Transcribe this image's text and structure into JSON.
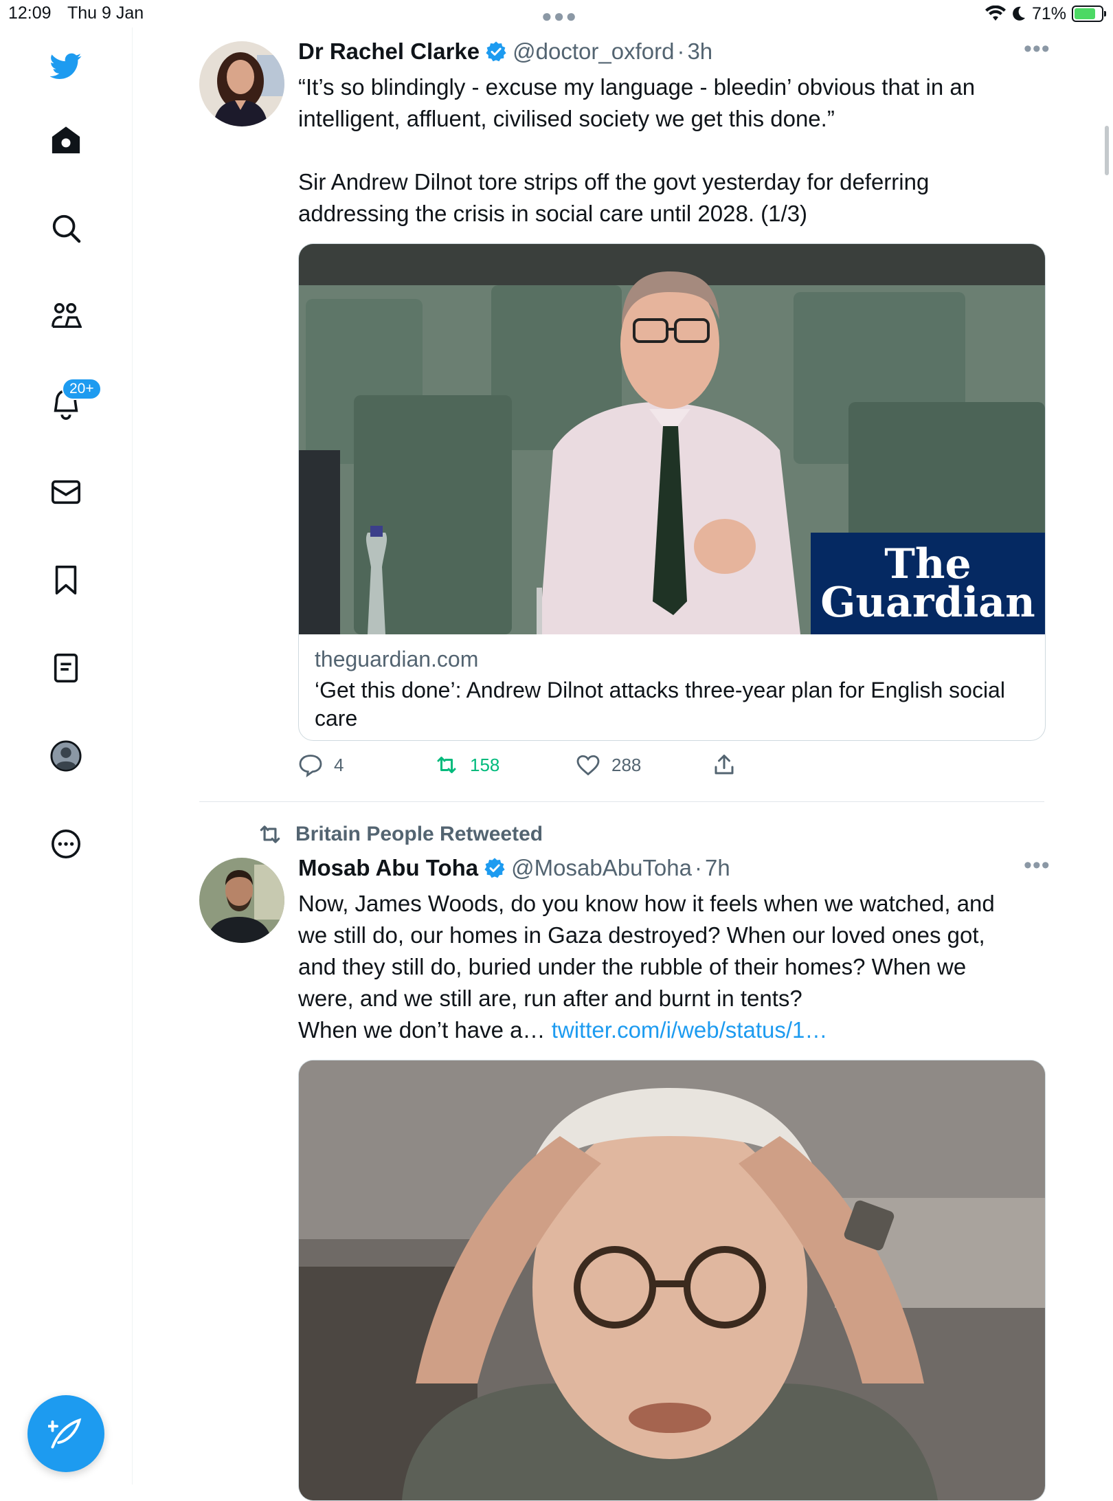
{
  "status_bar": {
    "time": "12:09",
    "date": "Thu 9 Jan",
    "battery": "71%",
    "battery_level": 0.71
  },
  "sidebar": {
    "items": [
      {
        "icon": "twitter-logo-icon"
      },
      {
        "icon": "home-icon"
      },
      {
        "icon": "search-icon"
      },
      {
        "icon": "communities-icon"
      },
      {
        "icon": "notifications-icon",
        "badge": "20+"
      },
      {
        "icon": "messages-icon"
      },
      {
        "icon": "bookmarks-icon"
      },
      {
        "icon": "lists-icon"
      },
      {
        "icon": "profile-icon"
      },
      {
        "icon": "more-icon"
      }
    ],
    "compose_icon": "compose-tweet-icon"
  },
  "tweets": [
    {
      "name": "Dr Rachel Clarke",
      "handle": "@doctor_oxford",
      "sep": "·",
      "time": "3h",
      "text": [
        "“It’s so blindingly - excuse my language - bleedin’ obvious that in an",
        "intelligent, affluent, civilised society we get this done.”",
        "",
        "Sir Andrew Dilnot tore strips off the govt yesterday for deferring",
        "addressing the crisis in social care until 2028. (1/3)"
      ],
      "card": {
        "logo_line1": "The",
        "logo_line2": "Guardian",
        "domain": "theguardian.com",
        "title": "‘Get this done’: Andrew Dilnot attacks three-year plan for English social care"
      },
      "actions": {
        "replies": "4",
        "retweets": "158",
        "likes": "288"
      }
    },
    {
      "retweeted_by": "Britain People Retweeted",
      "name": "Mosab Abu Toha",
      "handle": "@MosabAbuToha",
      "sep": "·",
      "time": "7h",
      "text": [
        "Now, James Woods, do you know how it feels when we watched, and",
        "we still do, our homes in Gaza destroyed? When our loved ones got,",
        "and they still do, buried under the rubble of their homes? When we",
        "were, and we still are, run after and burnt in tents?"
      ],
      "text_last": "When we don’t have a… ",
      "link": "twitter.com/i/web/status/1…"
    }
  ],
  "colors": {
    "accent": "#1d9bf0",
    "retweet": "#00ba7c",
    "muted": "#536471",
    "guardian": "#052962"
  }
}
